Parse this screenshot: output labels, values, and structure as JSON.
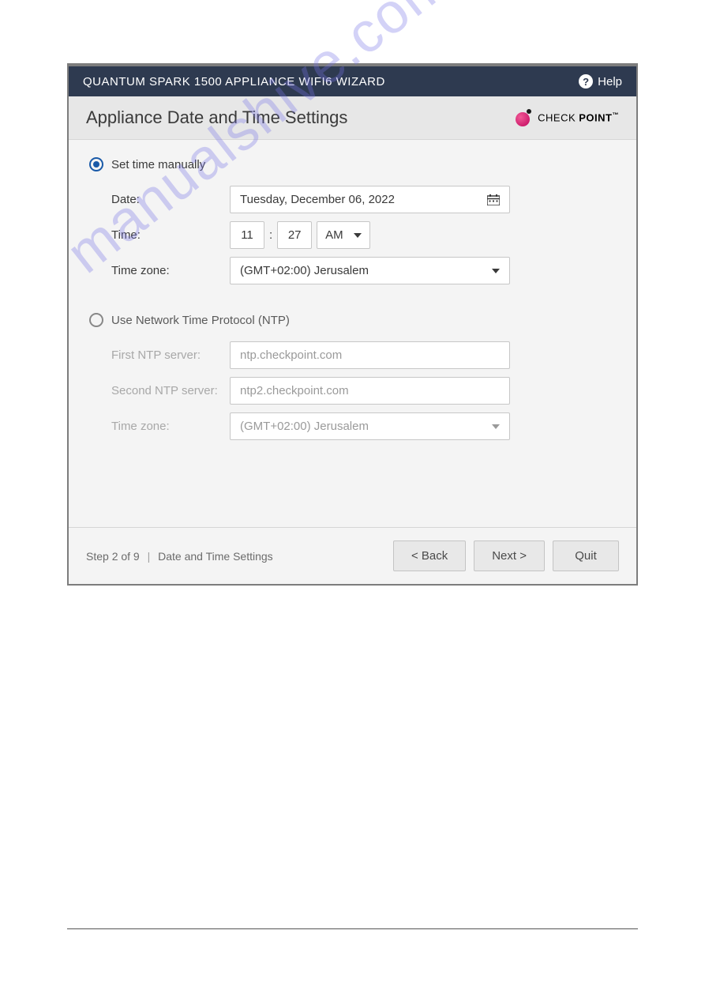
{
  "header": {
    "title": "QUANTUM SPARK 1500 APPLIANCE WIFI6 WIZARD",
    "help_label": "Help"
  },
  "title_bar": {
    "heading": "Appliance Date and Time Settings",
    "logo_brand_thin": "CHECK ",
    "logo_brand_bold": "POINT"
  },
  "manual": {
    "radio_label": "Set time manually",
    "date_label": "Date:",
    "date_value": "Tuesday, December 06, 2022",
    "time_label": "Time:",
    "hour": "11",
    "minute": "27",
    "ampm": "AM",
    "tz_label": "Time zone:",
    "tz_value": "(GMT+02:00) Jerusalem"
  },
  "ntp": {
    "radio_label": "Use Network Time Protocol (NTP)",
    "first_label": "First NTP server:",
    "first_value": "ntp.checkpoint.com",
    "second_label": "Second NTP server:",
    "second_value": "ntp2.checkpoint.com",
    "tz_label": "Time zone:",
    "tz_value": "(GMT+02:00) Jerusalem"
  },
  "footer": {
    "step_text": "Step 2 of 9",
    "step_title": "Date and Time Settings",
    "back": "< Back",
    "next": "Next >",
    "quit": "Quit"
  },
  "watermark": "manualshive.com"
}
